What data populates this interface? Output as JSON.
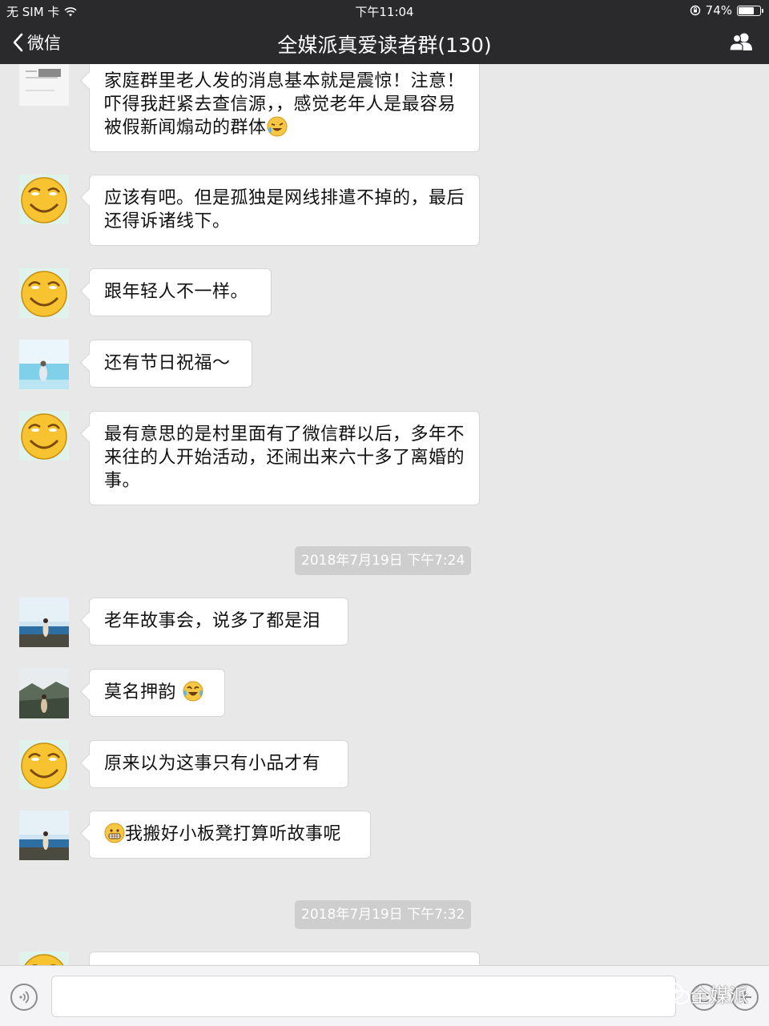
{
  "status_bar": {
    "carrier": "无 SIM 卡",
    "time": "下午11:04",
    "battery": "74%",
    "battery_level": 0.74
  },
  "nav": {
    "back_label": "微信",
    "title": "全媒派真爱读者群(130)"
  },
  "messages": [
    {
      "avatar": "document-thumbnail",
      "text": "家庭群里老人发的消息基本就是震惊！注意！吓得我赶紧去查信源，，感觉老年人是最容易被假新闻煽动的群体",
      "emoji": "laughing-tears"
    },
    {
      "avatar": "smiley-face",
      "text": "应该有吧。但是孤独是网线排遣不掉的，最后还得诉诸线下。"
    },
    {
      "avatar": "smiley-face",
      "text": "跟年轻人不一样。"
    },
    {
      "avatar": "sea-figure",
      "text": "还有节日祝福～"
    },
    {
      "avatar": "smiley-face",
      "text": "最有意思的是村里面有了微信群以后，多年不来往的人开始活动，还闹出来六十多了离婚的事。"
    },
    {
      "avatar": "beach-girl",
      "text": "老年故事会，说多了都是泪"
    },
    {
      "avatar": "mountain-girl",
      "text": "莫名押韵",
      "emoji": "tears-of-joy"
    },
    {
      "avatar": "smiley-face",
      "text": "原来以为这事只有小品才有"
    },
    {
      "avatar": "beach-girl",
      "text": "我搬好小板凳打算听故事呢",
      "emoji": "grimace"
    }
  ],
  "timestamps": [
    "2018年7月19日  下午7:24",
    "2018年7月19日  下午7:32"
  ],
  "watermark": "全媒派",
  "colors": {
    "nav_bg": "#2a2a2c",
    "chat_bg": "#e8e8e8",
    "bubble_bg": "#ffffff",
    "timestamp_bg": "#cecece"
  }
}
